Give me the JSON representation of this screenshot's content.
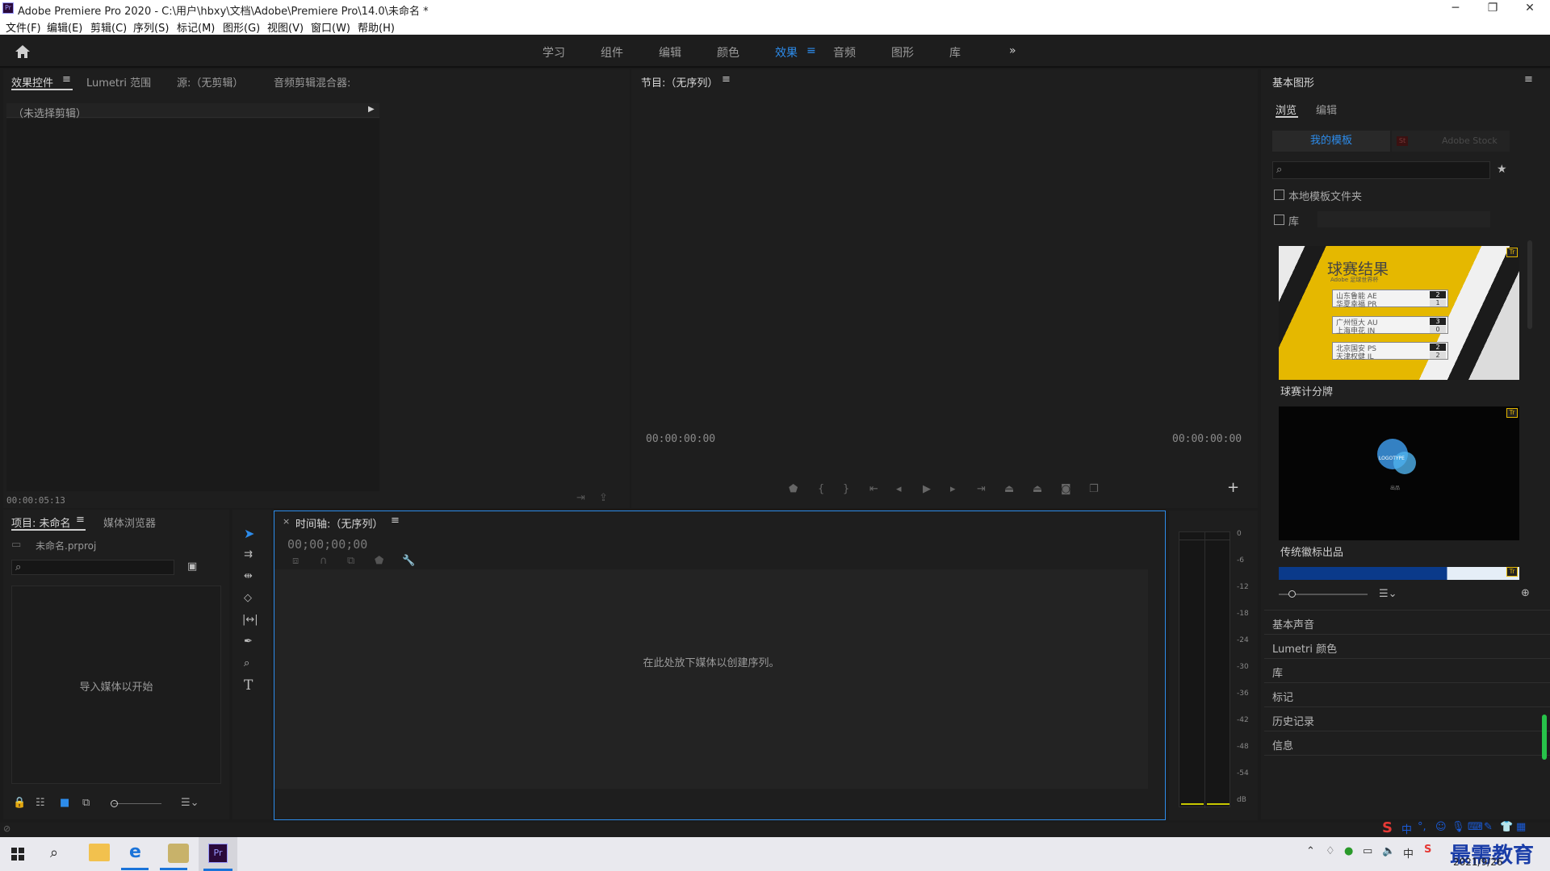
{
  "window": {
    "title": "Adobe Premiere Pro 2020 - C:\\用户\\hbxy\\文档\\Adobe\\Premiere Pro\\14.0\\未命名 *",
    "app_icon": "Pr",
    "minimize": "─",
    "maximize": "❐",
    "close": "✕"
  },
  "menu": [
    "文件(F)",
    "编辑(E)",
    "剪辑(C)",
    "序列(S)",
    "标记(M)",
    "图形(G)",
    "视图(V)",
    "窗口(W)",
    "帮助(H)"
  ],
  "workspaces": [
    "学习",
    "组件",
    "编辑",
    "颜色",
    "效果",
    "音频",
    "图形",
    "库"
  ],
  "workspace_active": "效果",
  "workspace_more": "»",
  "source_panel": {
    "tabs": [
      "效果控件",
      "Lumetri 范围",
      "源:（无剪辑）",
      "音频剪辑混合器:"
    ],
    "no_clip": "（未选择剪辑）",
    "timecode": "00:00:05:13"
  },
  "program_monitor": {
    "title": "节目:（无序列）",
    "tc_left": "00:00:00:00",
    "tc_right": "00:00:00:00"
  },
  "project_panel": {
    "tabs": [
      "项目: 未命名",
      "媒体浏览器"
    ],
    "file": "未命名.prproj",
    "search_placeholder": "",
    "empty": "导入媒体以开始"
  },
  "timeline": {
    "title": "时间轴:（无序列）",
    "timecode": "00;00;00;00",
    "empty": "在此处放下媒体以创建序列。"
  },
  "audio_meter": {
    "scale": [
      "0",
      "-6",
      "-12",
      "-18",
      "-24",
      "-30",
      "-36",
      "-42",
      "-48",
      "-54",
      "dB"
    ]
  },
  "essential_graphics": {
    "title": "基本图形",
    "tabs": [
      "浏览",
      "编辑"
    ],
    "source_tabs": [
      "我的模板",
      "Adobe Stock"
    ],
    "checkbox_local": "本地模板文件夹",
    "checkbox_lib": "库",
    "templates": [
      {
        "name": "球赛计分牌",
        "thumb_title": "球赛结果",
        "thumb_subtitle": "Adobe 足球世界杯",
        "rows": [
          [
            "山东鲁能 AE",
            "2"
          ],
          [
            "华夏幸福 PR",
            "1"
          ],
          [
            "广州恒大 AU",
            "3"
          ],
          [
            "上海申花 IN",
            "0"
          ],
          [
            "北京国安 PS",
            "2"
          ],
          [
            "天津权健 IL",
            "2"
          ]
        ]
      },
      {
        "name": "传统徽标出品",
        "thumb_logo": "LOGOTYPE",
        "thumb_caption": "出品"
      }
    ],
    "collapsed_panels": [
      "基本声音",
      "Lumetri 颜色",
      "库",
      "标记",
      "历史记录",
      "信息"
    ]
  },
  "taskbar": {
    "date": "2021/9/26",
    "time": "",
    "watermark": "最需教育",
    "ime": "中"
  }
}
